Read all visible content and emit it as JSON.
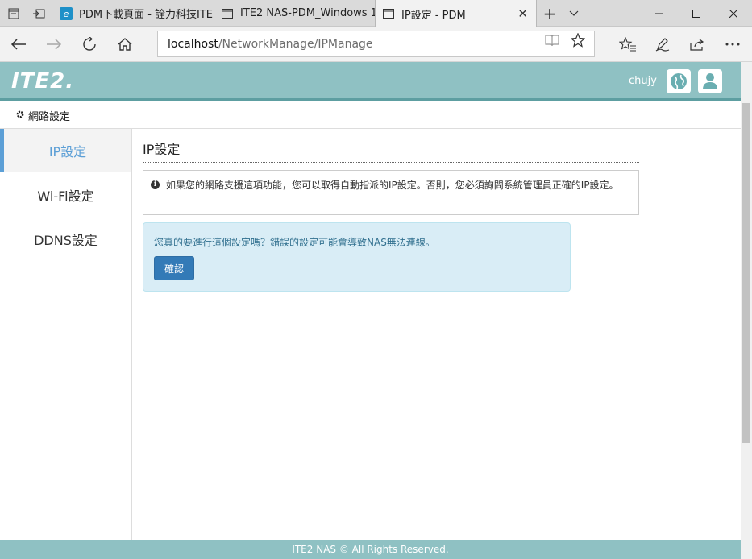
{
  "browser": {
    "tabs": [
      {
        "title": "PDM下載頁面 - 詮力科技ITE",
        "favicon": "edge-e-icon"
      },
      {
        "title": "ITE2 NAS-PDM_Windows 1(",
        "favicon": "page-icon"
      },
      {
        "title": "IP設定 - PDM",
        "favicon": "page-icon",
        "active": true
      }
    ],
    "address": {
      "host": "localhost",
      "path": "/NetworkManage/IPManage"
    }
  },
  "app": {
    "logo": "ITE2.",
    "username": "chujy",
    "breadcrumb": "網路設定",
    "sidebar": {
      "items": [
        {
          "label": "IP設定",
          "active": true
        },
        {
          "label": "Wi-Fi設定",
          "active": false
        },
        {
          "label": "DDNS設定",
          "active": false
        }
      ]
    },
    "content": {
      "title": "IP設定",
      "info": "如果您的網路支援這項功能，您可以取得自動指派的IP設定。否則，您必須詢問系統管理員正確的IP設定。",
      "alert": "您真的要進行這個設定嗎？錯誤的設定可能會導致NAS無法連線。",
      "confirm_label": "確認"
    },
    "footer": "ITE2 NAS © All Rights Reserved."
  },
  "colors": {
    "header": "#8fc1c3",
    "accent": "#5c9fd6",
    "alert_bg": "#d9edf6",
    "button": "#337ab7"
  }
}
